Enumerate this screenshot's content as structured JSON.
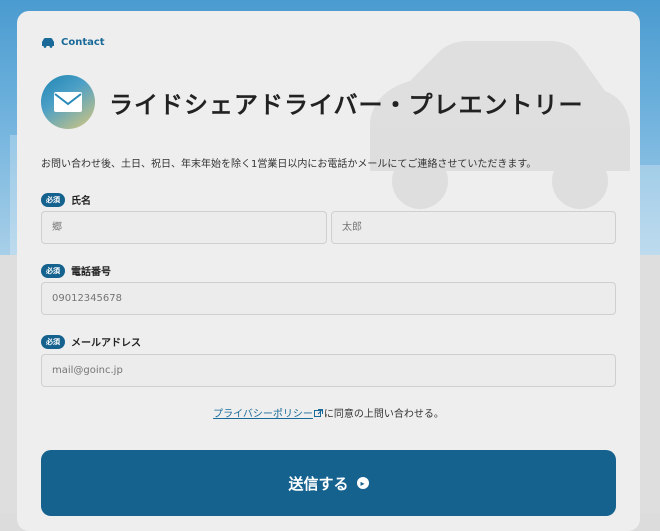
{
  "breadcrumb": {
    "label": "Contact",
    "icon": "car-icon"
  },
  "header": {
    "title": "ライドシェアドライバー・プレエントリー",
    "icon": "envelope-icon"
  },
  "intro_text": "お問い合わせ後、土日、祝日、年末年始を除く1営業日以内にお電話かメールにてご連絡させていただきます。",
  "form": {
    "required_badge": "必須",
    "name": {
      "label": "氏名",
      "last_placeholder": "郷",
      "first_placeholder": "太郎"
    },
    "phone": {
      "label": "電話番号",
      "placeholder": "09012345678"
    },
    "email": {
      "label": "メールアドレス",
      "placeholder": "mail@goinc.jp"
    },
    "privacy": {
      "link_text": "プライバシーポリシー",
      "suffix": "に同意の上問い合わせる。"
    },
    "submit": {
      "label": "送信する",
      "icon": "arrow-right-circle-icon"
    }
  },
  "colors": {
    "accent": "#15628f",
    "link": "#1a6a99",
    "card": "#eeeeee"
  }
}
